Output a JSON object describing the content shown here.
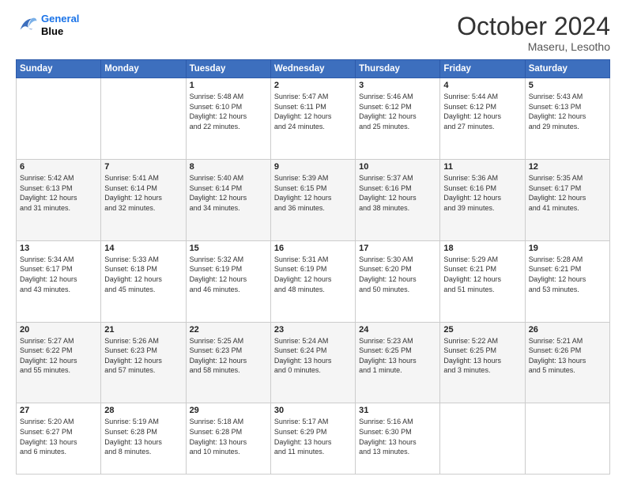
{
  "header": {
    "logo_line1": "General",
    "logo_line2": "Blue",
    "month_title": "October 2024",
    "location": "Maseru, Lesotho"
  },
  "days_of_week": [
    "Sunday",
    "Monday",
    "Tuesday",
    "Wednesday",
    "Thursday",
    "Friday",
    "Saturday"
  ],
  "weeks": [
    [
      {
        "day": "",
        "content": ""
      },
      {
        "day": "",
        "content": ""
      },
      {
        "day": "1",
        "content": "Sunrise: 5:48 AM\nSunset: 6:10 PM\nDaylight: 12 hours\nand 22 minutes."
      },
      {
        "day": "2",
        "content": "Sunrise: 5:47 AM\nSunset: 6:11 PM\nDaylight: 12 hours\nand 24 minutes."
      },
      {
        "day": "3",
        "content": "Sunrise: 5:46 AM\nSunset: 6:12 PM\nDaylight: 12 hours\nand 25 minutes."
      },
      {
        "day": "4",
        "content": "Sunrise: 5:44 AM\nSunset: 6:12 PM\nDaylight: 12 hours\nand 27 minutes."
      },
      {
        "day": "5",
        "content": "Sunrise: 5:43 AM\nSunset: 6:13 PM\nDaylight: 12 hours\nand 29 minutes."
      }
    ],
    [
      {
        "day": "6",
        "content": "Sunrise: 5:42 AM\nSunset: 6:13 PM\nDaylight: 12 hours\nand 31 minutes."
      },
      {
        "day": "7",
        "content": "Sunrise: 5:41 AM\nSunset: 6:14 PM\nDaylight: 12 hours\nand 32 minutes."
      },
      {
        "day": "8",
        "content": "Sunrise: 5:40 AM\nSunset: 6:14 PM\nDaylight: 12 hours\nand 34 minutes."
      },
      {
        "day": "9",
        "content": "Sunrise: 5:39 AM\nSunset: 6:15 PM\nDaylight: 12 hours\nand 36 minutes."
      },
      {
        "day": "10",
        "content": "Sunrise: 5:37 AM\nSunset: 6:16 PM\nDaylight: 12 hours\nand 38 minutes."
      },
      {
        "day": "11",
        "content": "Sunrise: 5:36 AM\nSunset: 6:16 PM\nDaylight: 12 hours\nand 39 minutes."
      },
      {
        "day": "12",
        "content": "Sunrise: 5:35 AM\nSunset: 6:17 PM\nDaylight: 12 hours\nand 41 minutes."
      }
    ],
    [
      {
        "day": "13",
        "content": "Sunrise: 5:34 AM\nSunset: 6:17 PM\nDaylight: 12 hours\nand 43 minutes."
      },
      {
        "day": "14",
        "content": "Sunrise: 5:33 AM\nSunset: 6:18 PM\nDaylight: 12 hours\nand 45 minutes."
      },
      {
        "day": "15",
        "content": "Sunrise: 5:32 AM\nSunset: 6:19 PM\nDaylight: 12 hours\nand 46 minutes."
      },
      {
        "day": "16",
        "content": "Sunrise: 5:31 AM\nSunset: 6:19 PM\nDaylight: 12 hours\nand 48 minutes."
      },
      {
        "day": "17",
        "content": "Sunrise: 5:30 AM\nSunset: 6:20 PM\nDaylight: 12 hours\nand 50 minutes."
      },
      {
        "day": "18",
        "content": "Sunrise: 5:29 AM\nSunset: 6:21 PM\nDaylight: 12 hours\nand 51 minutes."
      },
      {
        "day": "19",
        "content": "Sunrise: 5:28 AM\nSunset: 6:21 PM\nDaylight: 12 hours\nand 53 minutes."
      }
    ],
    [
      {
        "day": "20",
        "content": "Sunrise: 5:27 AM\nSunset: 6:22 PM\nDaylight: 12 hours\nand 55 minutes."
      },
      {
        "day": "21",
        "content": "Sunrise: 5:26 AM\nSunset: 6:23 PM\nDaylight: 12 hours\nand 57 minutes."
      },
      {
        "day": "22",
        "content": "Sunrise: 5:25 AM\nSunset: 6:23 PM\nDaylight: 12 hours\nand 58 minutes."
      },
      {
        "day": "23",
        "content": "Sunrise: 5:24 AM\nSunset: 6:24 PM\nDaylight: 13 hours\nand 0 minutes."
      },
      {
        "day": "24",
        "content": "Sunrise: 5:23 AM\nSunset: 6:25 PM\nDaylight: 13 hours\nand 1 minute."
      },
      {
        "day": "25",
        "content": "Sunrise: 5:22 AM\nSunset: 6:25 PM\nDaylight: 13 hours\nand 3 minutes."
      },
      {
        "day": "26",
        "content": "Sunrise: 5:21 AM\nSunset: 6:26 PM\nDaylight: 13 hours\nand 5 minutes."
      }
    ],
    [
      {
        "day": "27",
        "content": "Sunrise: 5:20 AM\nSunset: 6:27 PM\nDaylight: 13 hours\nand 6 minutes."
      },
      {
        "day": "28",
        "content": "Sunrise: 5:19 AM\nSunset: 6:28 PM\nDaylight: 13 hours\nand 8 minutes."
      },
      {
        "day": "29",
        "content": "Sunrise: 5:18 AM\nSunset: 6:28 PM\nDaylight: 13 hours\nand 10 minutes."
      },
      {
        "day": "30",
        "content": "Sunrise: 5:17 AM\nSunset: 6:29 PM\nDaylight: 13 hours\nand 11 minutes."
      },
      {
        "day": "31",
        "content": "Sunrise: 5:16 AM\nSunset: 6:30 PM\nDaylight: 13 hours\nand 13 minutes."
      },
      {
        "day": "",
        "content": ""
      },
      {
        "day": "",
        "content": ""
      }
    ]
  ]
}
